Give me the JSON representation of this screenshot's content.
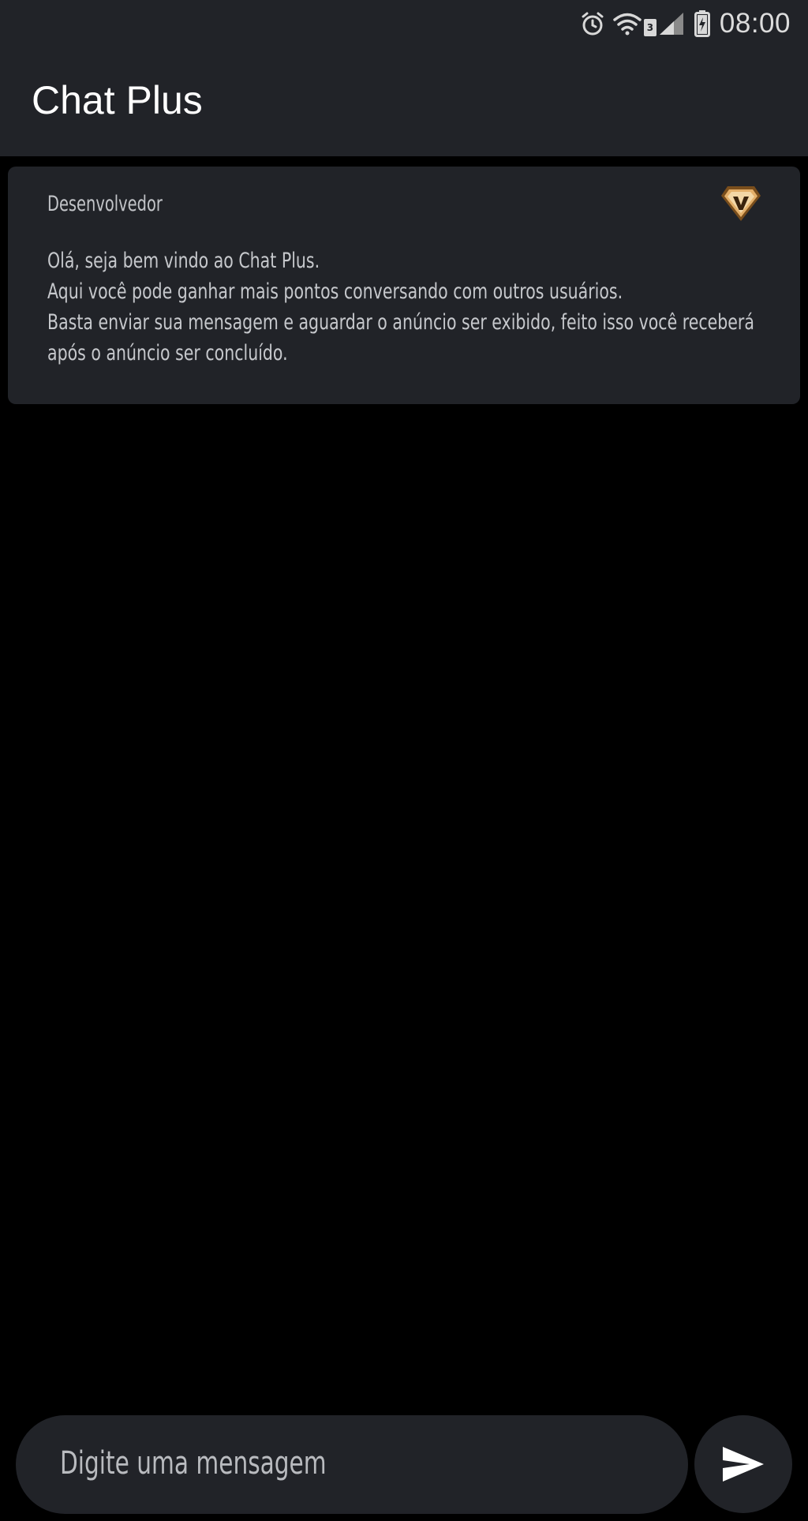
{
  "status_bar": {
    "time": "08:00",
    "sim_label": "3",
    "icons": [
      "alarm-icon",
      "wifi-icon",
      "signal-icon",
      "battery-charging-icon"
    ]
  },
  "app_bar": {
    "title": "Chat Plus"
  },
  "messages": [
    {
      "author": "Desenvolvedor",
      "badge_icon": "vip-badge-icon",
      "lines": [
        "Olá, seja bem vindo ao Chat Plus.",
        "Aqui você pode ganhar mais pontos conversando com outros usuários.",
        "Basta enviar sua mensagem e aguardar o anúncio ser exibido, feito isso você receberá",
        "após o anúncio ser concluído."
      ]
    }
  ],
  "composer": {
    "value": "",
    "placeholder": "Digite uma mensagem",
    "send_icon": "send-icon"
  },
  "colors": {
    "surface": "#212328",
    "background": "#000000",
    "title_text": "#ffffff",
    "body_text": "#c6c8cc",
    "badge_gold": "#d9a25f"
  }
}
